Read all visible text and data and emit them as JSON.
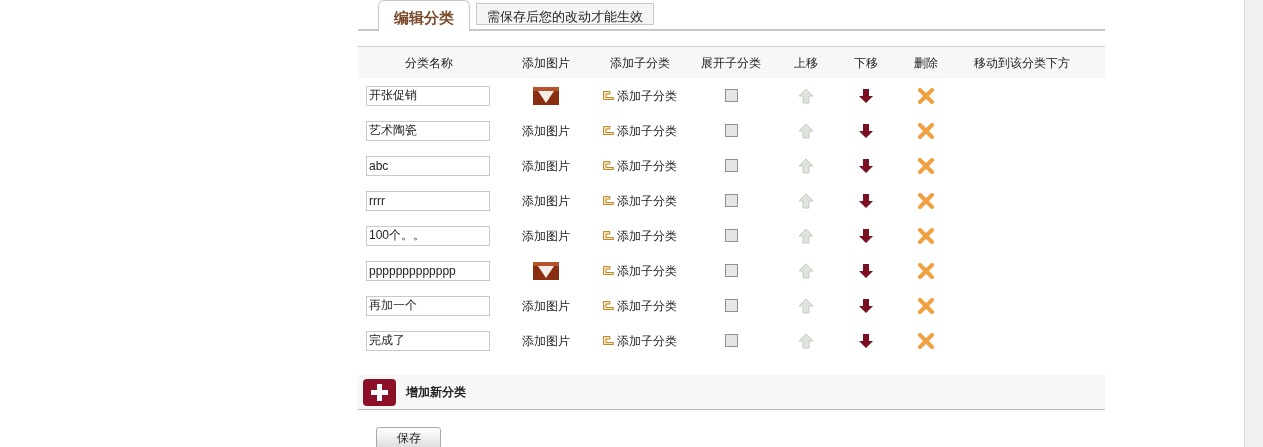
{
  "tabs": [
    {
      "label": "编辑分类",
      "selected": true
    },
    {
      "label": "需保存后您的改动才能生效",
      "selected": false
    }
  ],
  "columns": [
    "分类名称",
    "添加图片",
    "添加子分类",
    "展开子分类",
    "上移",
    "下移",
    "删除",
    "移动到该分类下方"
  ],
  "rows": [
    {
      "name": "开张促销",
      "add_child": "添加子分类",
      "expanded": false
    },
    {
      "name": "艺术陶瓷",
      "image": {
        "kind": "link",
        "label": "添加图片"
      },
      "add_child": "添加子分类",
      "expanded": false
    },
    {
      "name": "abc",
      "image": {
        "kind": "link",
        "label": "添加图片"
      },
      "add_child": "添加子分类",
      "expanded": false
    },
    {
      "name": "rrrr",
      "image": {
        "kind": "link",
        "label": "添加图片"
      },
      "add_child": "添加子分类",
      "expanded": false
    },
    {
      "name": "100个。。",
      "image": {
        "kind": "link",
        "label": "添加图片"
      },
      "add_child": "添加子分类",
      "expanded": false
    },
    {
      "name": "ppppppppppppp",
      "add_child": "添加子分类",
      "expanded": false
    },
    {
      "name": "再加一个",
      "image": {
        "kind": "link",
        "label": "添加图片"
      },
      "add_child": "添加子分类",
      "expanded": false
    },
    {
      "name": "完成了",
      "image": {
        "kind": "link",
        "label": "添加图片"
      },
      "add_child": "添加子分类",
      "expanded": false
    }
  ],
  "add_category": "增加新分类",
  "save_button": "保存"
}
